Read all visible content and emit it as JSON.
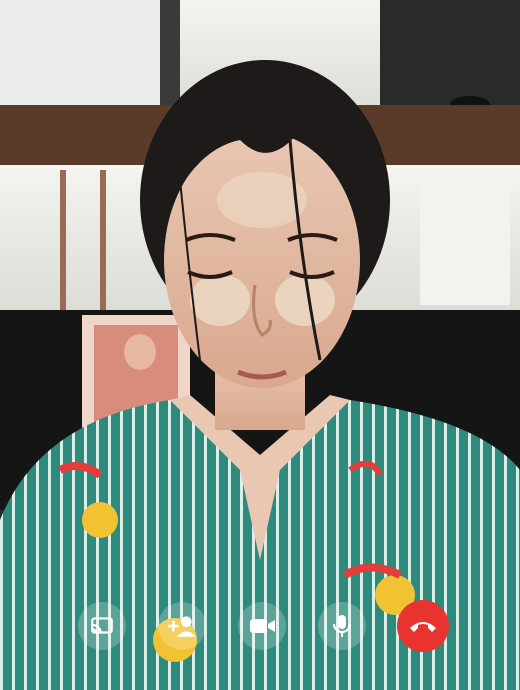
{
  "video_call": {
    "controls": [
      {
        "id": "screen-share",
        "icon": "cast-icon"
      },
      {
        "id": "add-person",
        "icon": "add-person-icon"
      },
      {
        "id": "camera",
        "icon": "video-camera-icon"
      },
      {
        "id": "microphone",
        "icon": "microphone-icon"
      },
      {
        "id": "end-call",
        "icon": "hang-up-icon"
      }
    ],
    "colors": {
      "end_call": "#e8332e",
      "control_bg": "rgba(255,255,255,0.22)",
      "shirt": "#2f8a7e"
    }
  }
}
